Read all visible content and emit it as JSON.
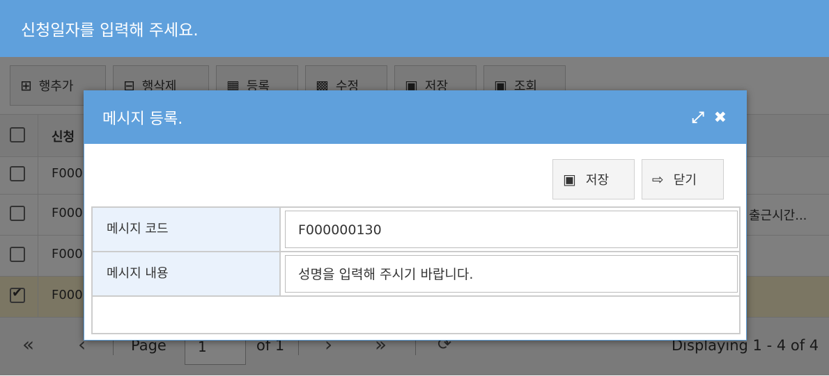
{
  "page": {
    "title": "신청일자를 입력해 주세요."
  },
  "toolbar": {
    "buttons": [
      {
        "label": "행추가",
        "icon": "plus-square-icon"
      },
      {
        "label": "행삭제",
        "icon": "minus-square-icon"
      },
      {
        "label": "등록",
        "icon": "table-icon"
      },
      {
        "label": "수정",
        "icon": "grid-icon"
      },
      {
        "label": "저장",
        "icon": "floppy-icon"
      },
      {
        "label": "조회",
        "icon": "floppy-icon"
      }
    ]
  },
  "grid": {
    "header": {
      "col1": "신청"
    },
    "rows": [
      {
        "code": "F000",
        "extra": "",
        "checked": false
      },
      {
        "code": "F000",
        "extra": "출근시간...",
        "checked": false
      },
      {
        "code": "F000",
        "extra": "",
        "checked": false
      },
      {
        "code": "F000",
        "extra": "",
        "checked": true
      }
    ]
  },
  "pager": {
    "first": "«",
    "prev": "‹",
    "page_label": "Page",
    "page_value": "1",
    "of_label": "of 1",
    "next": "›",
    "last": "»",
    "refresh_icon": "refresh-icon",
    "display": "Displaying 1 - 4 of 4"
  },
  "dialog": {
    "title": "메시지 등록.",
    "expand_icon": "expand-icon",
    "close_icon": "close-icon",
    "save_label": "저장",
    "close_label": "닫기",
    "fields": [
      {
        "label": "메시지 코드",
        "value": "F000000130"
      },
      {
        "label": "메시지 내용",
        "value": "성명을 입력해 주시기 바랍니다."
      }
    ]
  },
  "colors": {
    "header": "#5fa0dc",
    "label_bg": "#eaf2fc",
    "selected_row": "#f7ecc7"
  }
}
